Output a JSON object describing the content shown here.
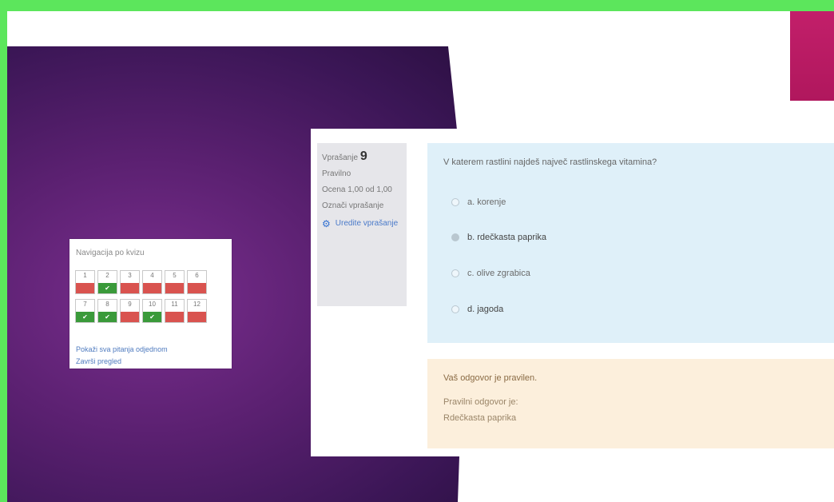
{
  "colors": {
    "background": "#5ce65c",
    "purple": "#5a2070",
    "magenta": "#c21f6a",
    "question_bg": "#dff0f9",
    "feedback_bg": "#fcefdc",
    "correct": "#3a9a3a",
    "wrong": "#d9534f"
  },
  "nav": {
    "title": "Navigacija po kvizu",
    "questions": [
      {
        "num": "1",
        "state": "wrong"
      },
      {
        "num": "2",
        "state": "correct"
      },
      {
        "num": "3",
        "state": "wrong"
      },
      {
        "num": "4",
        "state": "wrong"
      },
      {
        "num": "5",
        "state": "wrong"
      },
      {
        "num": "6",
        "state": "wrong"
      },
      {
        "num": "7",
        "state": "correct"
      },
      {
        "num": "8",
        "state": "correct"
      },
      {
        "num": "9",
        "state": "wrong"
      },
      {
        "num": "10",
        "state": "correct"
      },
      {
        "num": "11",
        "state": "wrong"
      },
      {
        "num": "12",
        "state": "wrong"
      }
    ],
    "check_mark": "✔",
    "show_all_link": "Pokaži sva pitanja odjednom",
    "finish_link": "Završi pregled"
  },
  "info": {
    "question_label": "Vprašanje",
    "question_number": "9",
    "status": "Pravilno",
    "score": "Ocena 1,00 od 1,00",
    "flag_label": "Označi vprašanje",
    "edit_label": "Uredite vprašanje"
  },
  "question": {
    "text": "V katerem rastlini najdeš največ rastlinskega vitamina?",
    "answers": [
      {
        "label": "a. korenje",
        "selected": false
      },
      {
        "label": "b. rdečkasta paprika",
        "selected": true
      },
      {
        "label": "c. olive zgrabica",
        "selected": false
      },
      {
        "label": "d. jagoda",
        "selected": false
      }
    ]
  },
  "feedback": {
    "result": "Vaš odgovor je pravilen.",
    "correct_prefix": "Pravilni odgovor je:",
    "correct_answer": "Rdečkasta paprika"
  }
}
